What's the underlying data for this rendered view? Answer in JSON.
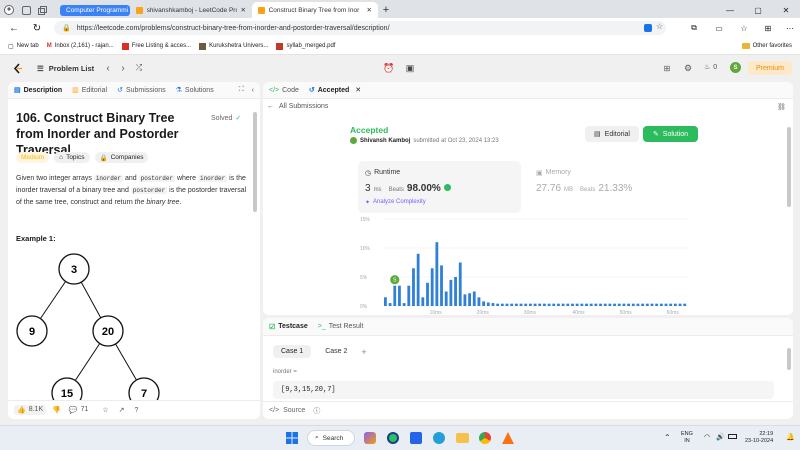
{
  "browser": {
    "tabs": [
      {
        "label": "Computer Programmi",
        "highlighted": true
      },
      {
        "label": "shivanshkamboj - LeetCode Profi",
        "active": false
      },
      {
        "label": "Construct Binary Tree from Inor",
        "active": true
      }
    ],
    "url": "https://leetcode.com/problems/construct-binary-tree-from-inorder-and-postorder-traversal/description/",
    "bookmarks": [
      "New tab",
      "Inbox (2,161) - rajan...",
      "Free Listing & acces...",
      "Kurukshetra Univers...",
      "syllab_merged.pdf"
    ],
    "other_favorites": "Other favorites"
  },
  "lc_nav": {
    "problem_list": "Problem List",
    "fire_count": "0",
    "avatar_letter": "S",
    "premium": "Premium"
  },
  "left_panel": {
    "tabs": [
      "Description",
      "Editorial",
      "Submissions",
      "Solutions"
    ],
    "title": "106. Construct Binary Tree from Inorder and Postorder Traversal",
    "solved": "Solved",
    "difficulty": "Medium",
    "topics": "Topics",
    "companies": "Companies",
    "desc": {
      "p1": "Given two integer arrays ",
      "c1": "inorder",
      "p2": " and ",
      "c2": "postorder",
      "p3": " where ",
      "c3": "inorder",
      "p4": " is the inorder traversal of a binary tree and ",
      "c4": "postorder",
      "p5": " is the postorder traversal of the same tree, construct and return ",
      "p6": "the binary tree",
      "p7": "."
    },
    "example_title": "Example 1:",
    "tree_nodes": [
      "3",
      "9",
      "20",
      "15",
      "7"
    ],
    "footer": {
      "likes": "8.1K",
      "comments": "71"
    }
  },
  "right_panel": {
    "tabs": [
      "Code",
      "Accepted"
    ],
    "back_link": "All Submissions",
    "status": "Accepted",
    "user": "Shivansh Kamboj",
    "submitted_at": "submitted at Oct 23, 2024 13:23",
    "editorial_btn": "Editorial",
    "solution_btn": "Solution",
    "runtime": {
      "label": "Runtime",
      "value": "3",
      "unit": "ms",
      "beats_label": "Beats",
      "beats": "98.00%"
    },
    "memory": {
      "label": "Memory",
      "value": "27.76",
      "unit": "MB",
      "beats_label": "Beats",
      "beats": "21.33%"
    },
    "analyze": "Analyze Complexity",
    "chart_y_ticks": [
      "15%",
      "10%",
      "5%",
      "0%"
    ],
    "chart_x_ticks": [
      "10ms",
      "20ms",
      "30ms",
      "40ms",
      "50ms",
      "60ms"
    ],
    "marker_letter": "S"
  },
  "testcase_panel": {
    "tabs": [
      "Testcase",
      "Test Result"
    ],
    "cases": [
      "Case 1",
      "Case 2"
    ],
    "add": "+",
    "field_label": "inorder =",
    "field_value": "[9,3,15,20,7]",
    "source": "Source"
  },
  "taskbar": {
    "search": "Search",
    "lang": "ENG",
    "region": "IN",
    "time": "22:19",
    "date": "23-10-2024"
  },
  "colors": {
    "accent": "#2cbb5d",
    "bar_blue": "#2f80d6",
    "orange": "#ffa116",
    "premium_bg": "#fde9c7"
  },
  "chart_data": {
    "type": "bar",
    "title": "Runtime",
    "xlabel": "",
    "ylabel": "",
    "ylim": [
      0,
      15
    ],
    "x_ticks": [
      "10ms",
      "20ms",
      "30ms",
      "40ms",
      "50ms",
      "60ms"
    ],
    "values": [
      1.5,
      0.5,
      3.5,
      3.5,
      0.5,
      3.5,
      6.5,
      9,
      1.5,
      4,
      6.5,
      11,
      7,
      2.5,
      4.5,
      5,
      7.5,
      2,
      2.2,
      2.5,
      1.5,
      0.8,
      0.6,
      0.5,
      0.4,
      0.4,
      0.4,
      0.4,
      0.4,
      0.4,
      0.4,
      0.4,
      0.4,
      0.4,
      0.4,
      0.4,
      0.4,
      0.4,
      0.4,
      0.4,
      0.4,
      0.4,
      0.4,
      0.4,
      0.4,
      0.4,
      0.4,
      0.4,
      0.4,
      0.4,
      0.4,
      0.4,
      0.4,
      0.4,
      0.4,
      0.4,
      0.4,
      0.4,
      0.4,
      0.4,
      0.4,
      0.4,
      0.4,
      0.4,
      0.4
    ],
    "highlight_index": 2
  }
}
